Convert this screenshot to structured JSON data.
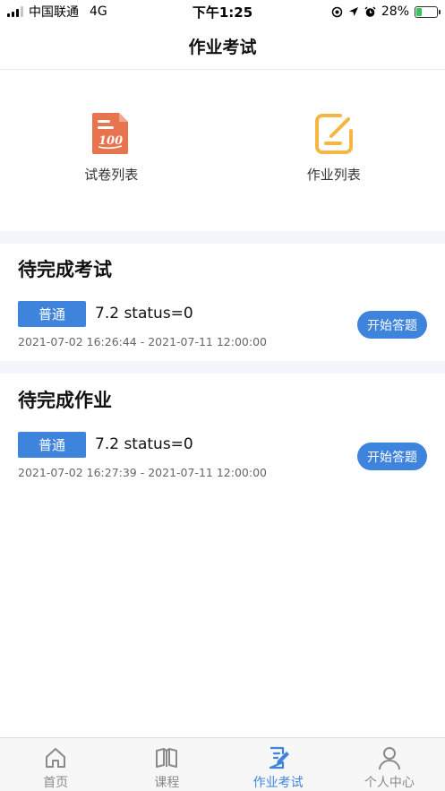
{
  "status_bar": {
    "carrier": "中国联通",
    "network": "4G",
    "time": "下午1:25",
    "battery_percent": "28%",
    "battery_level": 0.28
  },
  "nav": {
    "title": "作业考试"
  },
  "entries": [
    {
      "label": "试卷列表",
      "icon": "exam-paper-icon"
    },
    {
      "label": "作业列表",
      "icon": "homework-edit-icon"
    }
  ],
  "exam_section": {
    "title": "待完成考试",
    "items": [
      {
        "tag": "普通",
        "name": "7.2 status=0",
        "time": "2021-07-02 16:26:44 - 2021-07-11 12:00:00",
        "button": "开始答题"
      }
    ]
  },
  "homework_section": {
    "title": "待完成作业",
    "items": [
      {
        "tag": "普通",
        "name": "7.2 status=0",
        "time": "2021-07-02 16:27:39 - 2021-07-11 12:00:00",
        "button": "开始答题"
      }
    ]
  },
  "tabs": [
    {
      "label": "首页",
      "icon": "home-icon",
      "active": false
    },
    {
      "label": "课程",
      "icon": "book-icon",
      "active": false
    },
    {
      "label": "作业考试",
      "icon": "edit-icon",
      "active": true
    },
    {
      "label": "个人中心",
      "icon": "user-icon",
      "active": false
    }
  ],
  "colors": {
    "accent": "#3f84dc",
    "exam_icon": "#e8734f",
    "homework_icon": "#f5b642",
    "divider_band": "#f2f6fb"
  }
}
